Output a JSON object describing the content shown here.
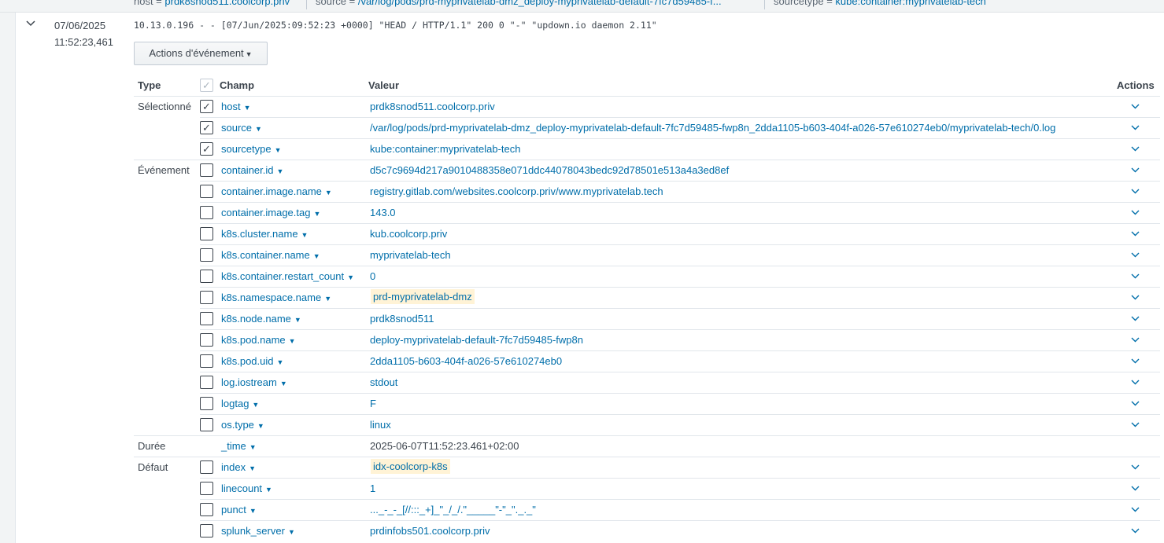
{
  "topbar": {
    "items": [
      {
        "key": "host = ",
        "value": "prdk8snod511.coolcorp.priv"
      },
      {
        "key": "source = ",
        "value": "/var/log/pods/prd-myprivatelab-dmz_deploy-myprivatelab-default-7fc7d59485-f..."
      },
      {
        "key": "sourcetype = ",
        "value": "kube:container:myprivatelab-tech"
      }
    ]
  },
  "event": {
    "date": "07/06/2025",
    "time": "11:52:23,461",
    "raw": "10.13.0.196 - - [07/Jun/2025:09:52:23 +0000] \"HEAD / HTTP/1.1\" 200 0 \"-\" \"updown.io daemon 2.11\"",
    "actions_button": "Actions d'événement"
  },
  "table": {
    "headers": {
      "type": "Type",
      "field": "Champ",
      "value": "Valeur",
      "actions": "Actions"
    },
    "rows": [
      {
        "type": "Sélectionné",
        "checked": true,
        "field": "host",
        "value": "prdk8snod511.coolcorp.priv"
      },
      {
        "type": "",
        "checked": true,
        "field": "source",
        "value": "/var/log/pods/prd-myprivatelab-dmz_deploy-myprivatelab-default-7fc7d59485-fwp8n_2dda1105-b603-404f-a026-57e610274eb0/myprivatelab-tech/0.log"
      },
      {
        "type": "",
        "checked": true,
        "field": "sourcetype",
        "value": "kube:container:myprivatelab-tech"
      },
      {
        "type": "Événement",
        "checked": false,
        "field": "container.id",
        "value": "d5c7c9694d217a9010488358e071ddc44078043bedc92d78501e513a4a3ed8ef"
      },
      {
        "type": "",
        "checked": false,
        "field": "container.image.name",
        "value": "registry.gitlab.com/websites.coolcorp.priv/www.myprivatelab.tech"
      },
      {
        "type": "",
        "checked": false,
        "field": "container.image.tag",
        "value": "143.0"
      },
      {
        "type": "",
        "checked": false,
        "field": "k8s.cluster.name",
        "value": "kub.coolcorp.priv"
      },
      {
        "type": "",
        "checked": false,
        "field": "k8s.container.name",
        "value": "myprivatelab-tech"
      },
      {
        "type": "",
        "checked": false,
        "field": "k8s.container.restart_count",
        "value": "0"
      },
      {
        "type": "",
        "checked": false,
        "field": "k8s.namespace.name",
        "value": "prd-myprivatelab-dmz",
        "highlight": true
      },
      {
        "type": "",
        "checked": false,
        "field": "k8s.node.name",
        "value": "prdk8snod511"
      },
      {
        "type": "",
        "checked": false,
        "field": "k8s.pod.name",
        "value": "deploy-myprivatelab-default-7fc7d59485-fwp8n"
      },
      {
        "type": "",
        "checked": false,
        "field": "k8s.pod.uid",
        "value": "2dda1105-b603-404f-a026-57e610274eb0"
      },
      {
        "type": "",
        "checked": false,
        "field": "log.iostream",
        "value": "stdout"
      },
      {
        "type": "",
        "checked": false,
        "field": "logtag",
        "value": "F"
      },
      {
        "type": "",
        "checked": false,
        "field": "os.type",
        "value": "linux"
      },
      {
        "type": "Durée",
        "checked": null,
        "field": "_time",
        "value": "2025-06-07T11:52:23.461+02:00",
        "plain": true,
        "no_action": true
      },
      {
        "type": "Défaut",
        "checked": false,
        "field": "index",
        "value": "idx-coolcorp-k8s",
        "highlight": true
      },
      {
        "type": "",
        "checked": false,
        "field": "linecount",
        "value": "1"
      },
      {
        "type": "",
        "checked": false,
        "field": "punct",
        "value": "..._-_-_[//:::_+]_\"_/_/.\"_____\"-\"_\"._._\""
      },
      {
        "type": "",
        "checked": false,
        "field": "splunk_server",
        "value": "prdinfobs501.coolcorp.priv"
      }
    ]
  },
  "icons": {
    "expand": "chevron-down-icon",
    "row_action": "chevron-down-icon",
    "checkbox": "checkmark-icon"
  }
}
